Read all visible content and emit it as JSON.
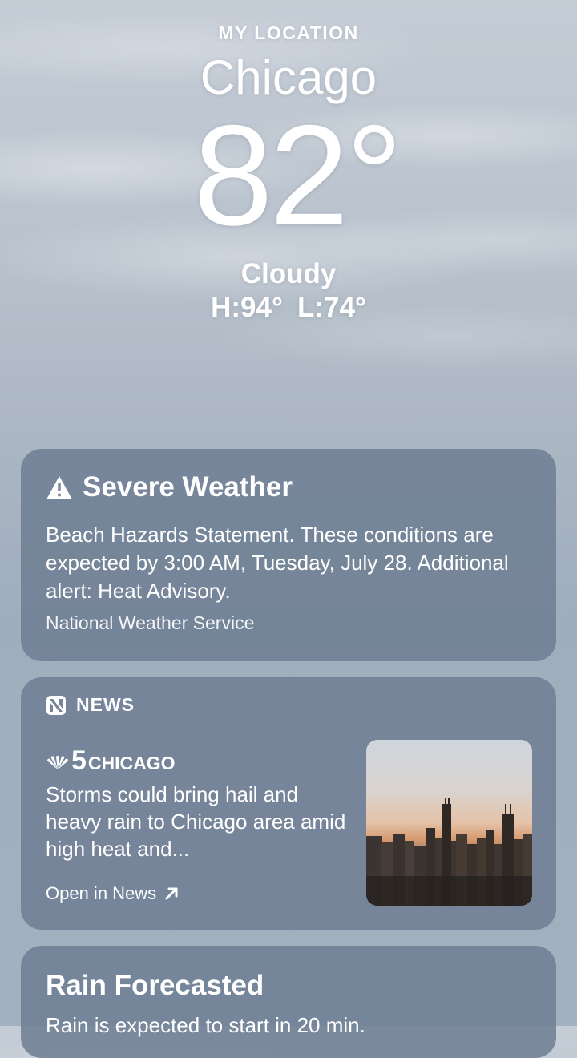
{
  "header": {
    "location_label": "MY LOCATION",
    "city": "Chicago",
    "temperature": "82°",
    "condition": "Cloudy",
    "high": "H:94°",
    "low": "L:74°"
  },
  "severe_weather": {
    "icon": "warning-triangle-icon",
    "title": "Severe Weather",
    "body": "Beach Hazards Statement. These conditions are expected by 3:00 AM, Tuesday, July 28. Additional alert: Heat Advisory.",
    "source": "National Weather Service"
  },
  "news": {
    "icon": "apple-news-icon",
    "label": "NEWS",
    "publisher_number": "5",
    "publisher_name": "CHICAGO",
    "headline": "Storms could bring hail and heavy rain to Chicago area amid high heat and...",
    "open_label": "Open in News",
    "image_icon": "chicago-skyline-photo"
  },
  "rain": {
    "title": "Rain Forecasted",
    "body": "Rain is expected to start in 20 min."
  }
}
